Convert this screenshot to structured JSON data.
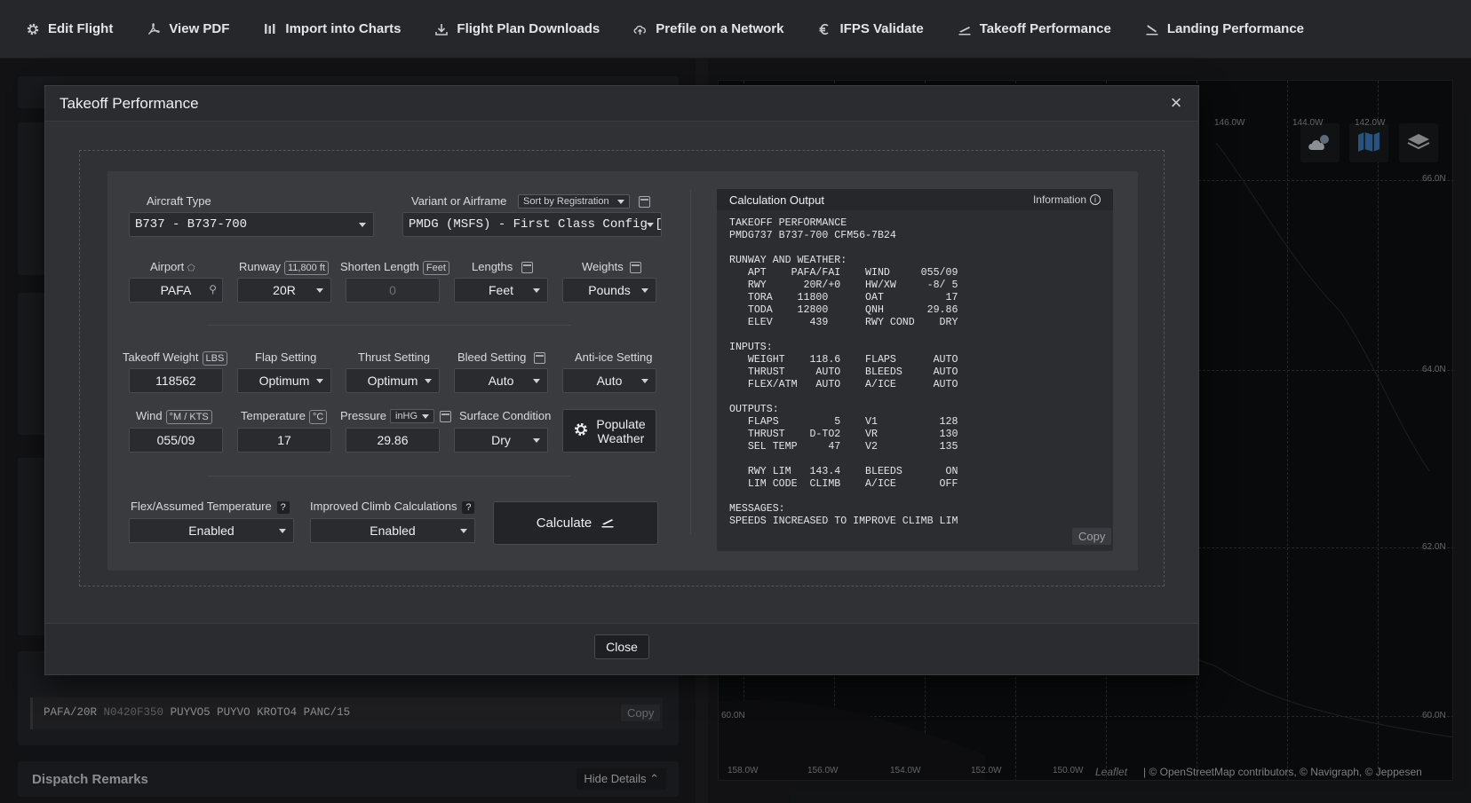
{
  "toolbar": {
    "items": [
      {
        "label": "Edit Flight",
        "icon": "gear-icon"
      },
      {
        "label": "View PDF",
        "icon": "pdf-icon"
      },
      {
        "label": "Import into Charts",
        "icon": "charts-icon"
      },
      {
        "label": "Flight Plan Downloads",
        "icon": "download-icon"
      },
      {
        "label": "Prefile on a Network",
        "icon": "cloud-upload-icon"
      },
      {
        "label": "IFPS Validate",
        "icon": "euro-icon"
      },
      {
        "label": "Takeoff Performance",
        "icon": "takeoff-icon"
      },
      {
        "label": "Landing Performance",
        "icon": "landing-icon"
      }
    ]
  },
  "background": {
    "route_text": "PAFA/20R",
    "route_speed": "N0420F350",
    "route_rest": "PUYVO5  PUYVO  KROTO4  PANC/15",
    "route_copy": "Copy",
    "dispatch_title": "Dispatch Remarks",
    "hide_details": "Hide Details",
    "map_attribution": "| © OpenStreetMap contributors, © Navigraph, © Jeppesen",
    "map_lon_labels": [
      "158.0W",
      "156.0W",
      "154.0W",
      "152.0W",
      "150.0W"
    ],
    "map_top_lon_labels": [
      "146.0W",
      "144.0W",
      "142.0W"
    ],
    "map_lat_labels": [
      "66.0N",
      "64.0N",
      "62.0N",
      "60.0N"
    ],
    "map_left_lat": "60.0N",
    "leaflet": "Leaflet"
  },
  "modal": {
    "title": "Takeoff Performance",
    "close_label": "Close",
    "aircraft_type": {
      "label": "Aircraft Type",
      "value": "B737 - B737-700"
    },
    "variant": {
      "label": "Variant or Airframe",
      "sort": "Sort by Registration",
      "value": "PMDG (MSFS) - First Class Config [c"
    },
    "airport": {
      "label": "Airport",
      "value": "PAFA"
    },
    "runway": {
      "label": "Runway",
      "tag": "11,800 ft",
      "value": "20R"
    },
    "shorten": {
      "label": "Shorten Length",
      "tag": "Feet",
      "value": "0"
    },
    "lengths": {
      "label": "Lengths",
      "value": "Feet"
    },
    "weights": {
      "label": "Weights",
      "value": "Pounds"
    },
    "takeoff_weight": {
      "label": "Takeoff Weight",
      "tag": "LBS",
      "value": "118562"
    },
    "flap": {
      "label": "Flap Setting",
      "value": "Optimum"
    },
    "thrust": {
      "label": "Thrust Setting",
      "value": "Optimum"
    },
    "bleed": {
      "label": "Bleed Setting",
      "value": "Auto"
    },
    "antiice": {
      "label": "Anti-ice Setting",
      "value": "Auto"
    },
    "wind": {
      "label": "Wind",
      "tag": "°M / KTS",
      "value": "055/09"
    },
    "temperature": {
      "label": "Temperature",
      "tag": "°C",
      "value": "17"
    },
    "pressure": {
      "label": "Pressure",
      "unit": "inHG",
      "value": "29.86"
    },
    "surface": {
      "label": "Surface Condition",
      "value": "Dry"
    },
    "populate": {
      "line1": "Populate",
      "line2": "Weather"
    },
    "flex": {
      "label": "Flex/Assumed Temperature",
      "help": "?",
      "value": "Enabled"
    },
    "climb": {
      "label": "Improved Climb Calculations",
      "help": "?",
      "value": "Enabled"
    },
    "calculate": "Calculate",
    "output": {
      "title": "Calculation Output",
      "info": "Information",
      "copy": "Copy",
      "text": "TAKEOFF PERFORMANCE\nPMDG737 B737-700 CFM56-7B24\n\nRUNWAY AND WEATHER:\n   APT    PAFA/FAI    WIND     055/09\n   RWY      20R/+0    HW/XW     -8/ 5\n   TORA    11800      OAT          17\n   TODA    12800      QNH       29.86\n   ELEV      439      RWY COND    DRY\n\nINPUTS:\n   WEIGHT    118.6    FLAPS      AUTO\n   THRUST     AUTO    BLEEDS     AUTO\n   FLEX/ATM   AUTO    A/ICE      AUTO\n\nOUTPUTS:\n   FLAPS         5    V1          128\n   THRUST    D-TO2    VR          130\n   SEL TEMP     47    V2          135\n\n   RWY LIM   143.4    BLEEDS       ON\n   LIM CODE  CLIMB    A/ICE       OFF\n\nMESSAGES:\nSPEEDS INCREASED TO IMPROVE CLIMB LIM"
    }
  }
}
